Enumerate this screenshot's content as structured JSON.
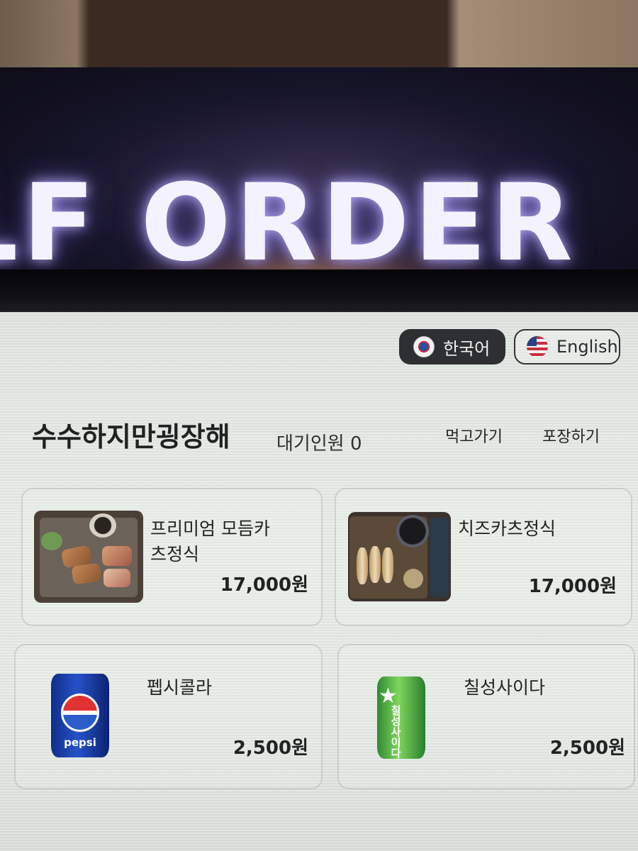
{
  "sign": {
    "text": "LF ORDER"
  },
  "language": {
    "korean": "한국어",
    "english": "English"
  },
  "header": {
    "store_name": "수수하지만굉장해",
    "wait_label": "대기인원 0"
  },
  "order_mode": {
    "eat_in": "먹고가기",
    "takeout": "포장하기"
  },
  "menu": {
    "items": [
      {
        "name_line1": "프리미엄 모듬카",
        "name_line2": "츠정식",
        "price": "17,000원",
        "image": "pork-cutlet-set-photo"
      },
      {
        "name": "치즈카츠정식",
        "price": "17,000원",
        "image": "cheese-cutlet-set-photo"
      },
      {
        "name": "펩시콜라",
        "price": "2,500원",
        "image": "pepsi-can",
        "can_text": "pepsi"
      },
      {
        "name": "칠성사이다",
        "price": "2,500원",
        "image": "chilsung-cider-can",
        "can_text": "칠성사이다"
      }
    ]
  },
  "colors": {
    "korean_button_bg": "#2d2f31",
    "screen_bg": "#e3e9e4",
    "sign_text": "#f4f2ff"
  }
}
